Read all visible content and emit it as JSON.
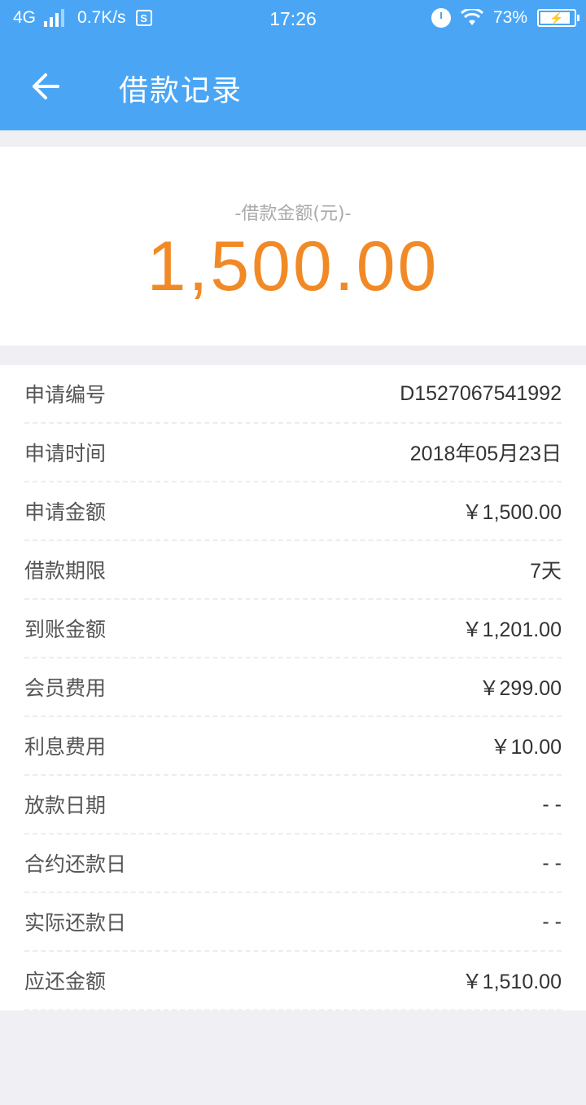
{
  "status_bar": {
    "network": "4G",
    "speed": "0.7K/s",
    "time": "17:26",
    "battery": "73%"
  },
  "header": {
    "title": "借款记录"
  },
  "summary": {
    "label": "-借款金额(元)-",
    "amount": "1,500.00"
  },
  "details": [
    {
      "label": "申请编号",
      "value": "D1527067541992"
    },
    {
      "label": "申请时间",
      "value": "2018年05月23日"
    },
    {
      "label": "申请金额",
      "value": "￥1,500.00"
    },
    {
      "label": "借款期限",
      "value": "7天"
    },
    {
      "label": "到账金额",
      "value": "￥1,201.00"
    },
    {
      "label": "会员费用",
      "value": "￥299.00"
    },
    {
      "label": "利息费用",
      "value": "￥10.00"
    },
    {
      "label": "放款日期",
      "value": "- -"
    },
    {
      "label": "合约还款日",
      "value": "- -"
    },
    {
      "label": "实际还款日",
      "value": "- -"
    },
    {
      "label": "应还金额",
      "value": "￥1,510.00"
    }
  ],
  "colors": {
    "header": "#4aa6f5",
    "amount": "#f18a26",
    "background": "#efeff4"
  }
}
